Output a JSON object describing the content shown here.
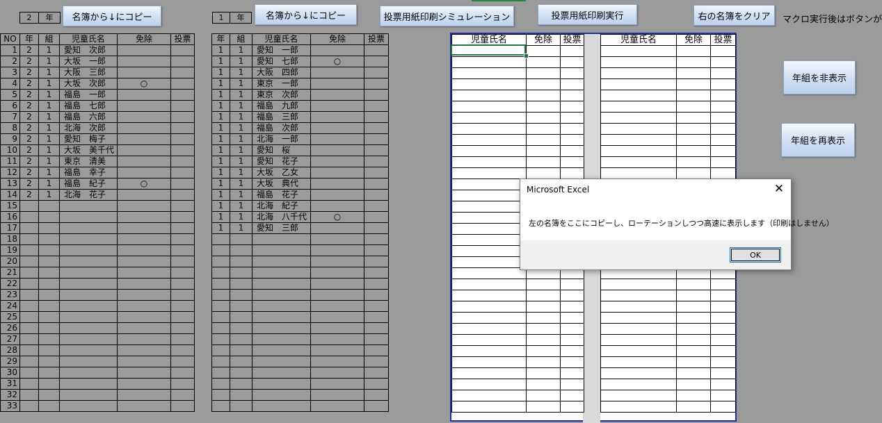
{
  "left": {
    "grade_value": "2",
    "grade_label": "年",
    "copy_button": "名簿から↓にコピー",
    "headers": [
      "NO",
      "年",
      "組",
      "児童氏名",
      "免除",
      "投票"
    ],
    "rows": [
      [
        "1",
        "2",
        "1",
        "愛知　次郎",
        ""
      ],
      [
        "2",
        "2",
        "1",
        "大坂　一郎",
        ""
      ],
      [
        "3",
        "2",
        "1",
        "大阪　三郎",
        ""
      ],
      [
        "4",
        "2",
        "1",
        "大坂　次郎",
        "○"
      ],
      [
        "5",
        "2",
        "1",
        "福島　一郎",
        ""
      ],
      [
        "6",
        "2",
        "1",
        "福島　七郎",
        ""
      ],
      [
        "7",
        "2",
        "1",
        "福島　六郎",
        ""
      ],
      [
        "8",
        "2",
        "1",
        "北海　次郎",
        ""
      ],
      [
        "9",
        "2",
        "1",
        "愛知　梅子",
        ""
      ],
      [
        "10",
        "2",
        "1",
        "大坂　美千代",
        ""
      ],
      [
        "11",
        "2",
        "1",
        "東京　清美",
        ""
      ],
      [
        "12",
        "2",
        "1",
        "福島　幸子",
        ""
      ],
      [
        "13",
        "2",
        "1",
        "福島　紀子",
        "○"
      ],
      [
        "14",
        "2",
        "1",
        "北海　花子",
        ""
      ]
    ],
    "empty_row_numbers": [
      "15",
      "16",
      "17",
      "18",
      "19",
      "20",
      "21",
      "22",
      "23",
      "24",
      "25",
      "26",
      "27",
      "28",
      "29",
      "30",
      "31",
      "32",
      "33"
    ]
  },
  "middle": {
    "grade_value": "1",
    "grade_label": "年",
    "copy_button": "名簿から↓にコピー",
    "headers": [
      "年",
      "組",
      "児童氏名",
      "免除",
      "投票"
    ],
    "rows": [
      [
        "1",
        "1",
        "愛知　一郎",
        ""
      ],
      [
        "1",
        "1",
        "愛知　七郎",
        "○"
      ],
      [
        "1",
        "1",
        "大阪　四郎",
        ""
      ],
      [
        "1",
        "1",
        "東京　一郎",
        ""
      ],
      [
        "1",
        "1",
        "東京　次郎",
        ""
      ],
      [
        "1",
        "1",
        "福島　九郎",
        ""
      ],
      [
        "1",
        "1",
        "福島　三郎",
        ""
      ],
      [
        "1",
        "1",
        "福島　次郎",
        ""
      ],
      [
        "1",
        "1",
        "北海　一郎",
        ""
      ],
      [
        "1",
        "1",
        "愛知　桜",
        ""
      ],
      [
        "1",
        "1",
        "愛知　花子",
        ""
      ],
      [
        "1",
        "1",
        "大坂　乙女",
        ""
      ],
      [
        "1",
        "1",
        "大坂　典代",
        ""
      ],
      [
        "1",
        "1",
        "福島　花子",
        ""
      ],
      [
        "1",
        "1",
        "北海　紀子",
        ""
      ],
      [
        "1",
        "1",
        "北海　八千代",
        "○"
      ],
      [
        "1",
        "1",
        "愛知　三郎",
        ""
      ]
    ]
  },
  "toolbar": {
    "simulate_button": "投票用紙印刷シミュレーション",
    "print_button": "投票用紙印刷実行",
    "clear_button": "右の名簿をクリア",
    "macro_note": "マクロ実行後はボタンが",
    "hide_button": "年組を非表示",
    "show_button": "年組を再表示"
  },
  "sheet": {
    "headers": [
      "児童氏名",
      "免除",
      "投票",
      "児童氏名",
      "免除",
      "投票"
    ]
  },
  "dialog": {
    "title": "Microsoft Excel",
    "close": "✕",
    "message": "左の名簿をここにコピーし、ローテーションしつつ高速に表示します（印刷はしません）",
    "ok": "OK"
  }
}
